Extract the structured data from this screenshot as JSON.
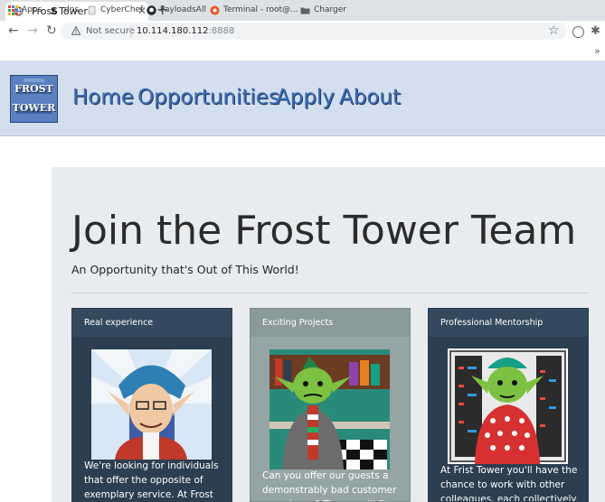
{
  "browser": {
    "tab_title": "Frost Tower",
    "tab_close": "✕",
    "new_tab": "+",
    "back": "←",
    "forward": "→",
    "reload": "↻",
    "not_secure": "Not secure",
    "url_host": "10.114.180.112",
    "url_port": ":8888",
    "bookmark_star": "☆",
    "extensions": "✱",
    "more_bookmarks": "»",
    "bookmarks": [
      {
        "label": "Apps"
      },
      {
        "label": "dns"
      },
      {
        "label": "CyberChef"
      },
      {
        "label": "PayloadsAll"
      },
      {
        "label": "Terminal - root@..."
      },
      {
        "label": "Charger"
      }
    ]
  },
  "site": {
    "logo_line1": "FROST",
    "logo_line2": "TOWER",
    "nav": [
      "Home",
      "Opportunities",
      "Apply",
      "About"
    ]
  },
  "jumbotron": {
    "title": "Join the Frost Tower Team",
    "subtitle": "An Opportunity that's Out of This World!"
  },
  "cards": [
    {
      "header": "Real experience",
      "text": "We're looking for individuals that offer the opposite of exemplary service. At Frost Tower, the truly"
    },
    {
      "header": "Exciting Projects",
      "text": "Can you offer our guests a demonstrably bad customer experience? Then you'll fit right in"
    },
    {
      "header": "Professional Mentorship",
      "text": "At Frist Tower you'll have the chance to work with other colleagues, each collectively"
    }
  ]
}
